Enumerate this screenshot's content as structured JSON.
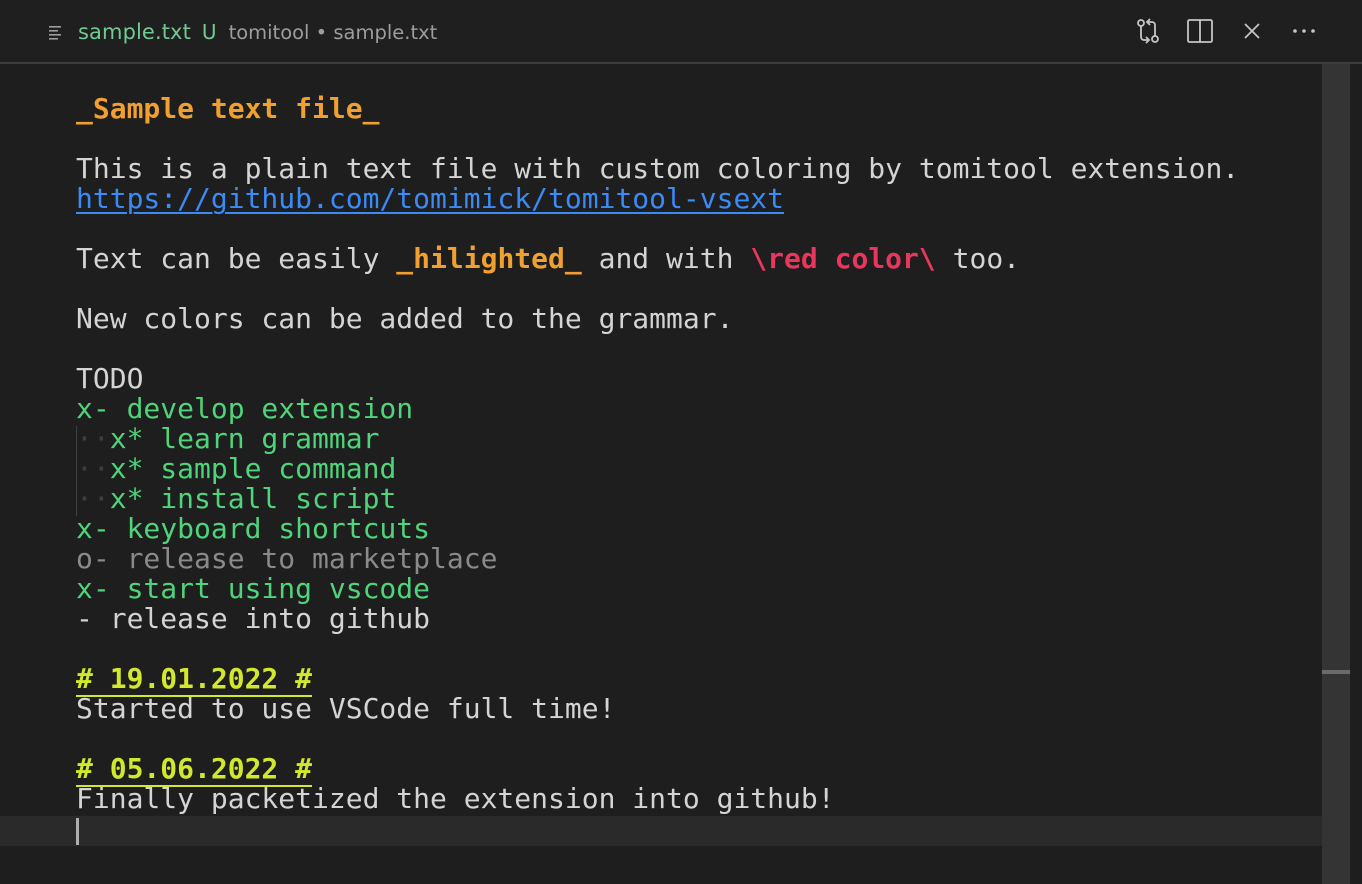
{
  "tab": {
    "filename": "sample.txt",
    "status": "U",
    "description": "tomitool • sample.txt",
    "icon": "text-file-icon"
  },
  "actions": [
    {
      "name": "open-changes-icon"
    },
    {
      "name": "split-editor-icon"
    },
    {
      "name": "close-icon"
    },
    {
      "name": "more-actions-icon"
    }
  ],
  "colors": {
    "header": "#f0a030",
    "link": "#3a8bf5",
    "red": "#e8365d",
    "done": "#4ed47a",
    "open": "#8a8a8a",
    "date": "#d1e82c",
    "text": "#d4d4d4",
    "tab_filename": "#73c991"
  },
  "editor": {
    "lines": {
      "l1": "_Sample text file_",
      "l3": "This is a plain text file with custom coloring by tomitool extension.",
      "l4": "https://github.com/tomimick/tomitool-vsext",
      "l6_a": "Text can be easily ",
      "l6_b": "_hilighted_",
      "l6_c": " and with ",
      "l6_d": "\\red color\\",
      "l6_e": " too.",
      "l8": "New colors can be added to the grammar.",
      "l10": "TODO",
      "l11": "x- develop extension",
      "l12": "x* learn grammar",
      "l13": "x* sample command",
      "l14": "x* install script",
      "l15": "x- keyboard shortcuts",
      "l16": "o- release to marketplace",
      "l17": "x- start using vscode",
      "l18": "- release into github",
      "l20": "# 19.01.2022 #",
      "l21": "Started to use VSCode full time!",
      "l23": "# 05.06.2022 #",
      "l24": "Finally packetized the extension into github!",
      "l25": ""
    }
  }
}
